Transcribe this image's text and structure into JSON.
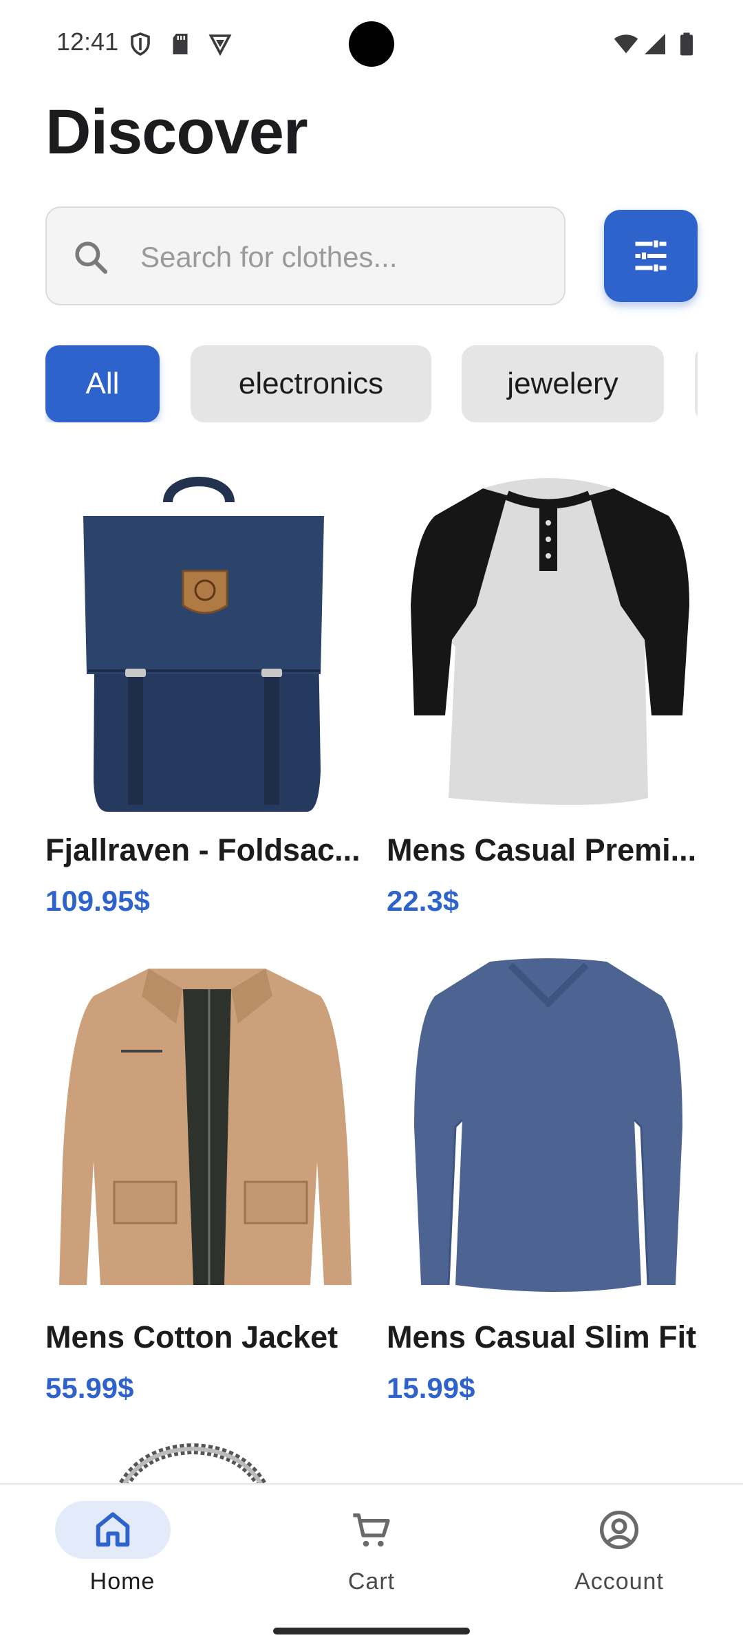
{
  "status_bar": {
    "time": "12:41",
    "left_icons": [
      "shield-icon",
      "sd-card-icon",
      "vpn-icon"
    ],
    "right_icons": [
      "wifi-icon",
      "cellular-signal-icon",
      "battery-icon"
    ]
  },
  "page": {
    "title": "Discover"
  },
  "search": {
    "placeholder": "Search for clothes...",
    "value": "",
    "icon": "search-icon"
  },
  "filter_button": {
    "icon": "tune-sliders-icon",
    "color": "#2f63cc"
  },
  "categories": [
    {
      "label": "All",
      "active": true
    },
    {
      "label": "electronics",
      "active": false
    },
    {
      "label": "jewelery",
      "active": false
    }
  ],
  "products": [
    {
      "title": "Fjallraven - Foldsac...",
      "price": "109.95$",
      "image": "backpack"
    },
    {
      "title": "Mens Casual Premi...",
      "price": "22.3$",
      "image": "raglan-shirt"
    },
    {
      "title": "Mens Cotton Jacket",
      "price": "55.99$",
      "image": "jacket"
    },
    {
      "title": "Mens Casual Slim Fit",
      "price": "15.99$",
      "image": "long-sleeve-shirt"
    }
  ],
  "bottom_nav": {
    "items": [
      {
        "label": "Home",
        "icon": "home-icon",
        "active": true
      },
      {
        "label": "Cart",
        "icon": "cart-icon",
        "active": false
      },
      {
        "label": "Account",
        "icon": "account-icon",
        "active": false
      }
    ]
  },
  "colors": {
    "accent": "#2f63cc",
    "chip_bg": "#e5e5e5",
    "text": "#1c1c1e"
  }
}
